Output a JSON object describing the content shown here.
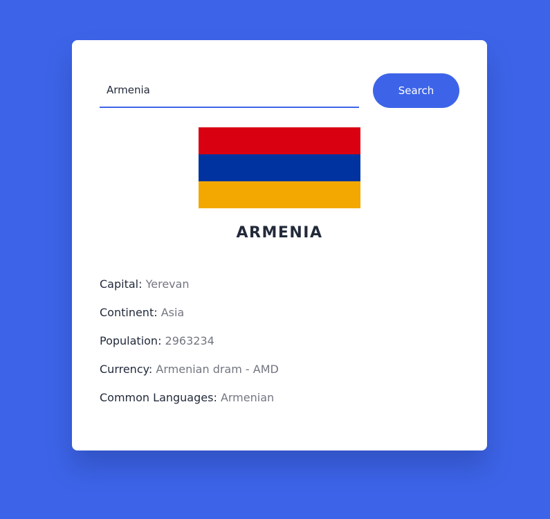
{
  "search": {
    "value": "Armenia",
    "button_label": "Search"
  },
  "country": {
    "name": "ARMENIA",
    "flag": {
      "stripes": [
        "#d90012",
        "#0033a0",
        "#f2a800"
      ]
    },
    "details": [
      {
        "label": "Capital:",
        "value": "Yerevan"
      },
      {
        "label": "Continent:",
        "value": "Asia"
      },
      {
        "label": "Population:",
        "value": "2963234"
      },
      {
        "label": "Currency:",
        "value": "Armenian dram - AMD"
      },
      {
        "label": "Common Languages:",
        "value": "Armenian"
      }
    ]
  },
  "colors": {
    "background": "#3d64e8",
    "accent": "#3d64e8",
    "label_text": "#222a3a",
    "value_text": "#737680"
  }
}
